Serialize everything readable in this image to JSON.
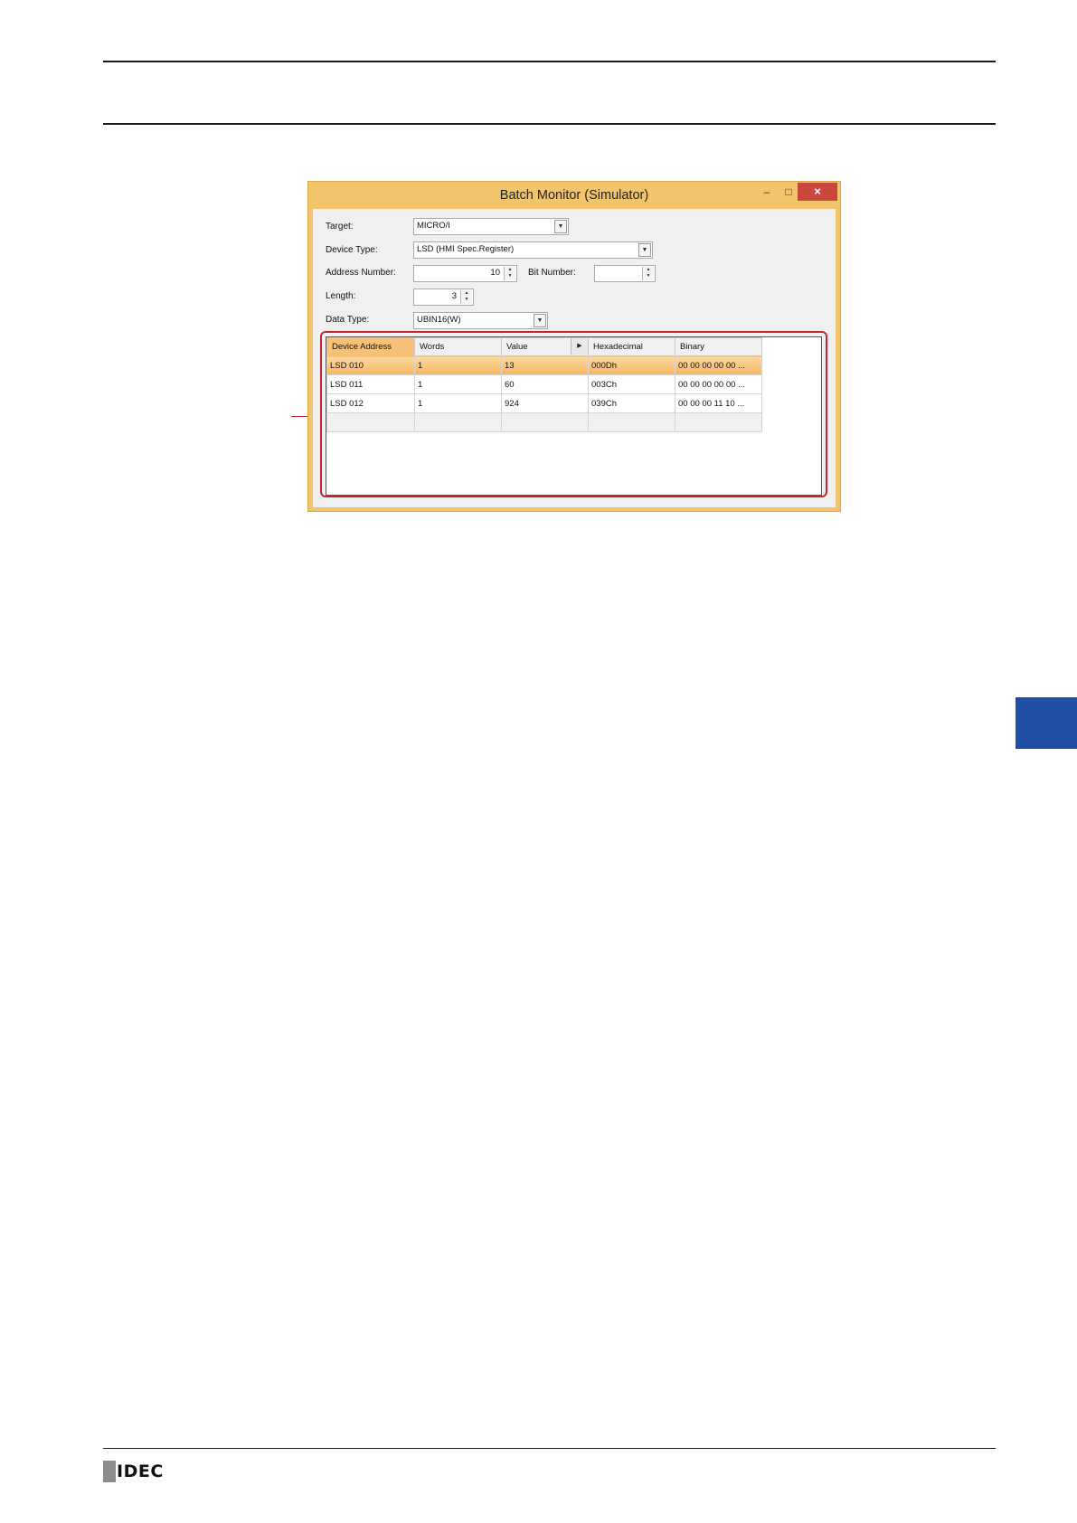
{
  "window": {
    "title": "Batch Monitor (Simulator)",
    "controls": {
      "minimize": "–",
      "maximize": "□",
      "close": "×"
    }
  },
  "form": {
    "target": {
      "label": "Target:",
      "value": "MICRO/I"
    },
    "device_type": {
      "label": "Device Type:",
      "value": "LSD (HMI Spec.Register)"
    },
    "address_number": {
      "label": "Address Number:",
      "value": "10"
    },
    "bit_number": {
      "label": "Bit Number:",
      "value": ""
    },
    "length": {
      "label": "Length:",
      "value": "3"
    },
    "data_type": {
      "label": "Data Type:",
      "value": "UBIN16(W)"
    }
  },
  "grid": {
    "columns": [
      "Device Address",
      "Words",
      "Value",
      "Hexadecimal",
      "Binary"
    ],
    "rows": [
      {
        "device_address": "LSD 010",
        "words": "1",
        "value": "13",
        "hexadecimal": "000Dh",
        "binary": "00 00 00 00 00 ..."
      },
      {
        "device_address": "LSD 011",
        "words": "1",
        "value": "60",
        "hexadecimal": "003Ch",
        "binary": "00 00 00 00 00 ..."
      },
      {
        "device_address": "LSD 012",
        "words": "1",
        "value": "924",
        "hexadecimal": "039Ch",
        "binary": "00 00 00 11 10 ..."
      }
    ]
  },
  "footer": {
    "logo": "IDEC"
  },
  "colors": {
    "window_frame": "#f2c46b",
    "selected_row": "#f6b65e",
    "highlight_border": "#c0272d",
    "side_tab": "#1f4ea3"
  }
}
